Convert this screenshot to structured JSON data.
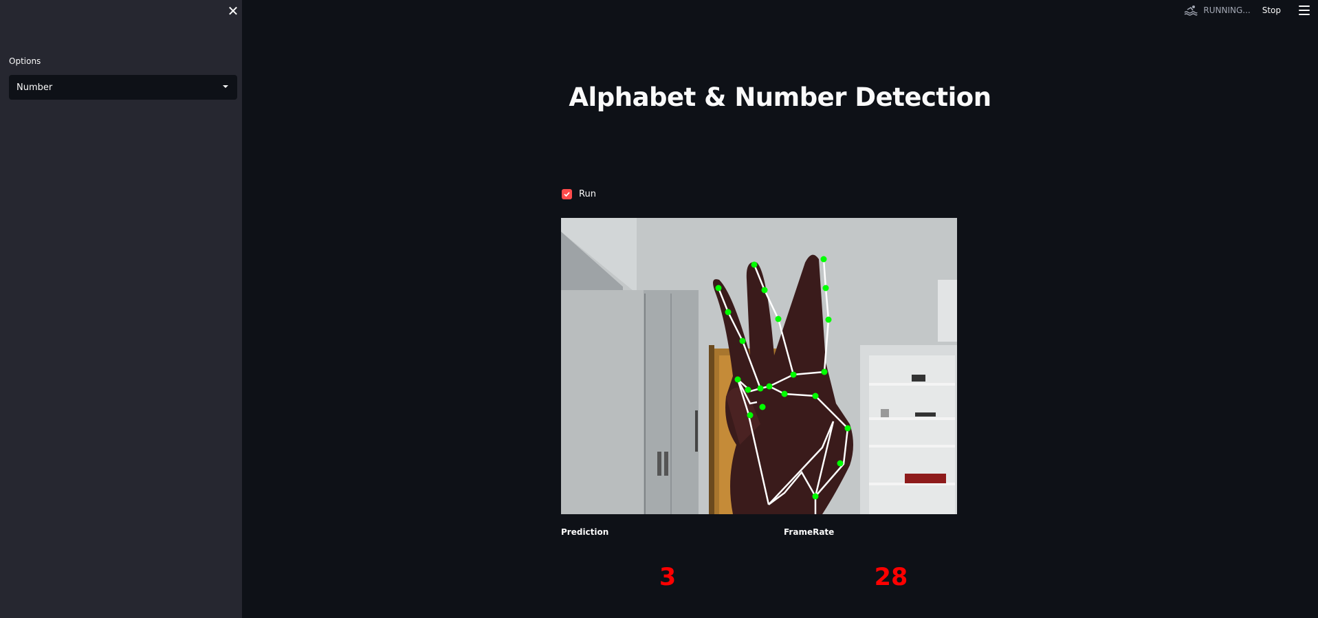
{
  "sidebar": {
    "options_label": "Options",
    "select_value": "Number"
  },
  "topbar": {
    "status": "RUNNING...",
    "stop_label": "Stop"
  },
  "main": {
    "title": "Alphabet & Number Detection",
    "run_label": "Run",
    "run_checked": true
  },
  "metrics": {
    "prediction_label": "Prediction",
    "prediction_value": "3",
    "framerate_label": "FrameRate",
    "framerate_value": "28"
  },
  "colors": {
    "accent": "#ff4b4b",
    "metric_value": "#ff0000",
    "landmark": "#00ff00",
    "background": "#0e1117",
    "sidebar": "#262730"
  }
}
